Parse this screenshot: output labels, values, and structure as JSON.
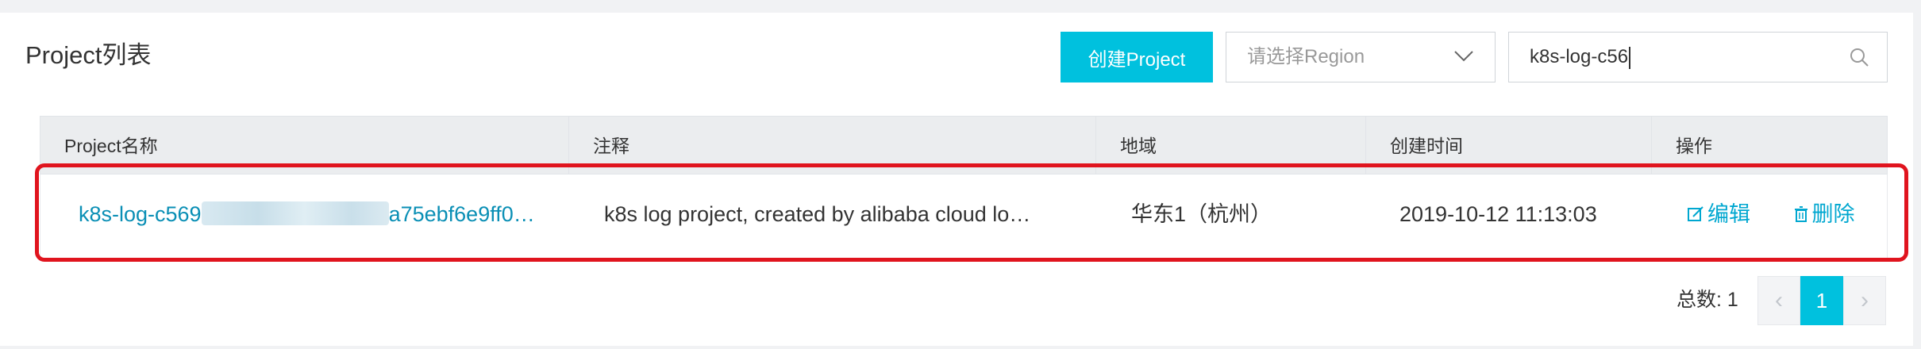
{
  "header": {
    "title": "Project列表",
    "create_button": "创建Project",
    "region_placeholder": "请选择Region",
    "search_value": "k8s-log-c56"
  },
  "table": {
    "columns": [
      "Project名称",
      "注释",
      "地域",
      "创建时间",
      "操作"
    ],
    "rows": [
      {
        "name_prefix": "k8s-log-c569",
        "name_suffix": "a75ebf6e9ff0…",
        "comment": "k8s log project, created by alibaba cloud lo…",
        "region": "华东1（杭州）",
        "created": "2019-10-12 11:13:03",
        "edit_label": "编辑",
        "delete_label": "删除"
      }
    ]
  },
  "pagination": {
    "total_label": "总数: 1",
    "prev": "‹",
    "current": "1",
    "next": "›"
  },
  "colors": {
    "accent": "#00c1de",
    "link": "#0a8fb5",
    "highlight": "#e0141e"
  }
}
